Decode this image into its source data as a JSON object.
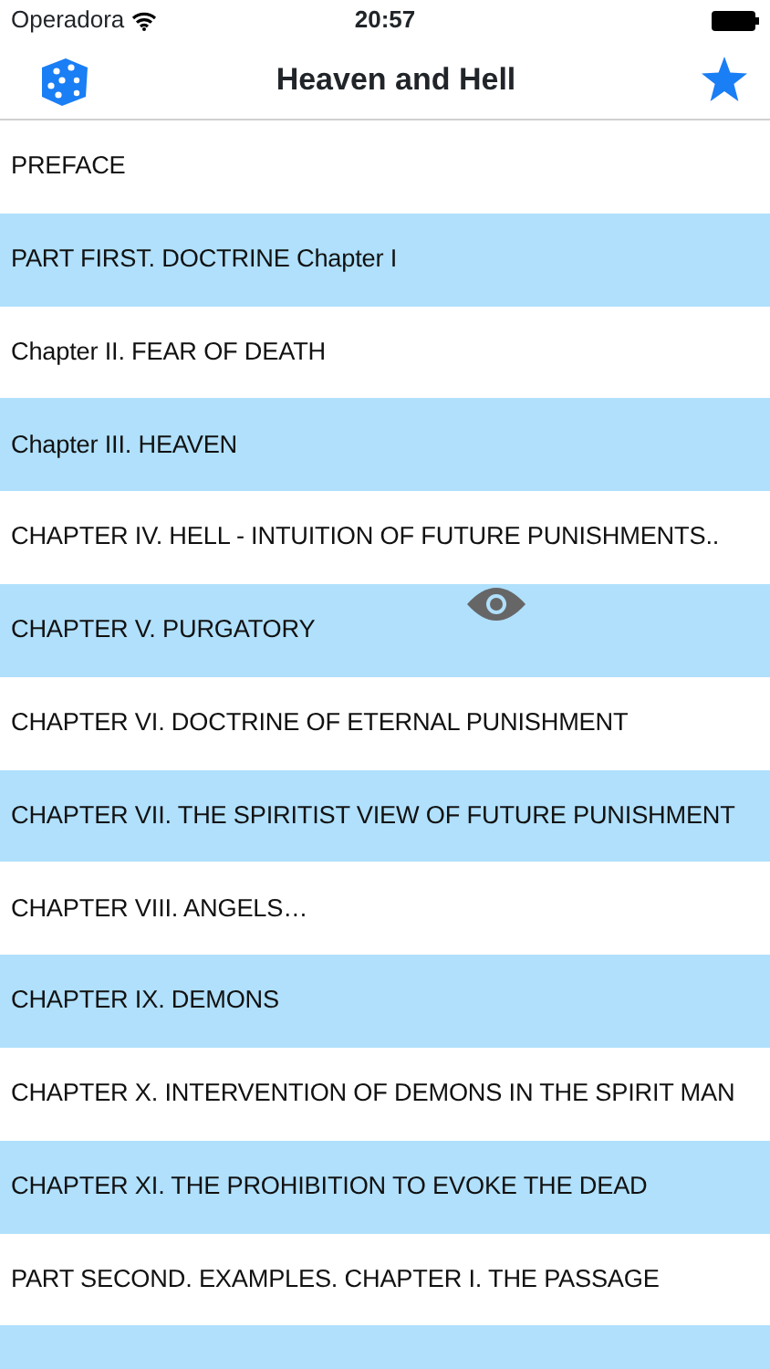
{
  "status_bar": {
    "carrier": "Operadora",
    "time": "20:57"
  },
  "nav_bar": {
    "title": "Heaven and Hell"
  },
  "chapters": [
    {
      "title": "PREFACE"
    },
    {
      "title": "PART FIRST. DOCTRINE Chapter I"
    },
    {
      "title": "Chapter II. FEAR OF DEATH"
    },
    {
      "title": "Chapter III. HEAVEN"
    },
    {
      "title": "CHAPTER IV. HELL - INTUITION OF FUTURE PUNISHMENTS.."
    },
    {
      "title": "CHAPTER V. PURGATORY"
    },
    {
      "title": "CHAPTER VI. DOCTRINE OF ETERNAL PUNISHMENT"
    },
    {
      "title": "CHAPTER VII. THE SPIRITIST VIEW OF FUTURE PUNISHMENT"
    },
    {
      "title": "CHAPTER VIII. ANGELS…"
    },
    {
      "title": "CHAPTER IX. DEMONS"
    },
    {
      "title": "CHAPTER X. INTERVENTION OF DEMONS IN THE SPIRIT MAN"
    },
    {
      "title": "CHAPTER XI. THE PROHIBITION TO EVOKE THE DEAD"
    },
    {
      "title": "PART SECOND. EXAMPLES. CHAPTER I. THE PASSAGE"
    }
  ]
}
